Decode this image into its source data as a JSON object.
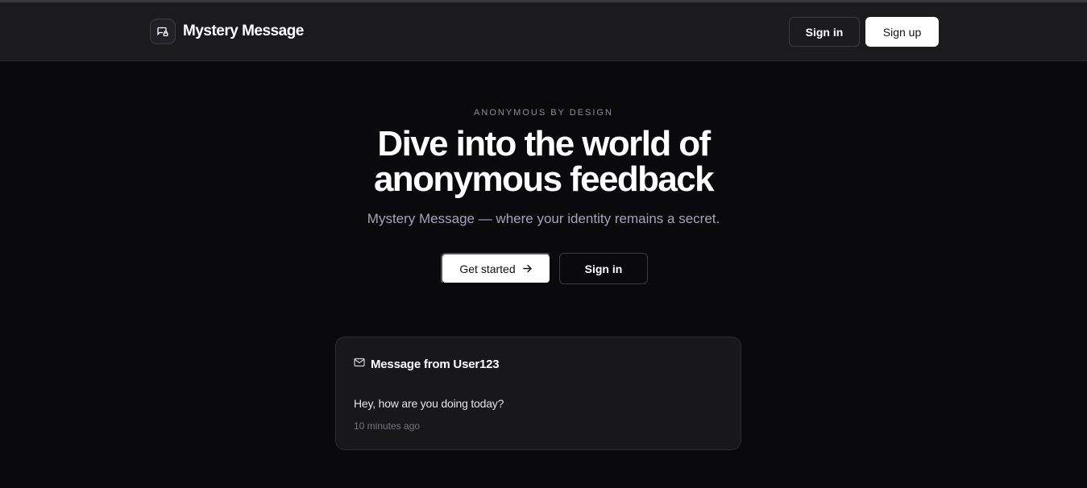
{
  "header": {
    "brand_name": "Mystery Message",
    "brand_icon": "message-square-lock-icon",
    "signin_label": "Sign in",
    "signup_label": "Sign up"
  },
  "hero": {
    "eyebrow": "ANONYMOUS BY DESIGN",
    "title_line1": "Dive into the world of",
    "title_line2": "anonymous feedback",
    "subtitle": "Mystery Message — where your identity remains a secret.",
    "primary_cta": "Get started",
    "primary_cta_icon": "arrow-right-icon",
    "secondary_cta": "Sign in"
  },
  "message_card": {
    "icon": "mail-icon",
    "title": "Message from User123",
    "body": "Hey, how are you doing today?",
    "time": "10 minutes ago"
  },
  "colors": {
    "background": "#0a0a0c",
    "navbar": "#1b1b1e",
    "card": "#18181b",
    "accent_text": "#a6a3b8"
  }
}
